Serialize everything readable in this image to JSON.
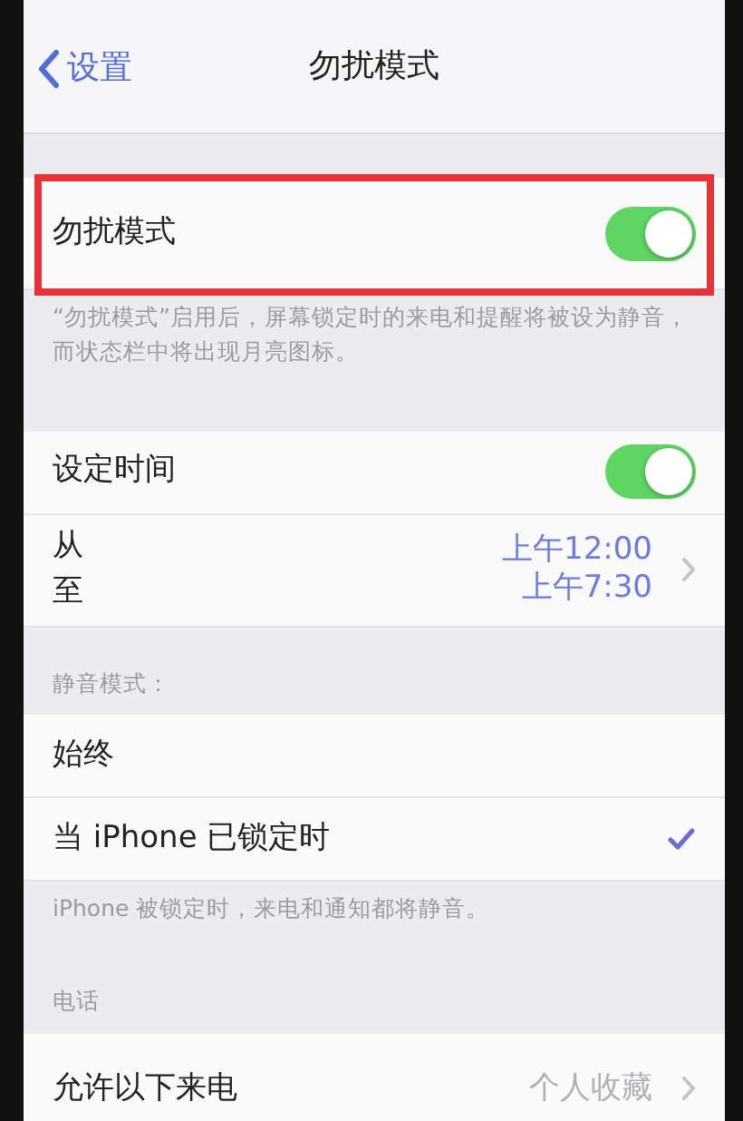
{
  "nav": {
    "back": "设置",
    "title": "勿扰模式"
  },
  "sections": [
    {
      "rows": [
        {
          "kind": "toggle",
          "label": "勿扰模式",
          "on": true,
          "highlighted": true
        }
      ],
      "footer": "“勿扰模式”启用后，屏幕锁定时的来电和提醒将被设为静音，而状态栏中将出现月亮图标。"
    },
    {
      "rows": [
        {
          "kind": "toggle",
          "label": "设定时间",
          "on": true,
          "highlighted": false
        },
        {
          "kind": "schedule",
          "from_label": "从",
          "to_label": "至",
          "from_time": "上午12:00",
          "to_time": "上午7:30"
        }
      ]
    },
    {
      "header": "静音模式：",
      "rows": [
        {
          "kind": "option",
          "label": "始终",
          "selected": false
        },
        {
          "kind": "option",
          "label": "当 iPhone 已锁定时",
          "selected": true
        }
      ],
      "footer": "iPhone 被锁定时，来电和通知都将静音。"
    },
    {
      "header": "电话",
      "rows": [
        {
          "kind": "detail",
          "label": "允许以下来电",
          "value": "个人收藏"
        }
      ]
    }
  ]
}
